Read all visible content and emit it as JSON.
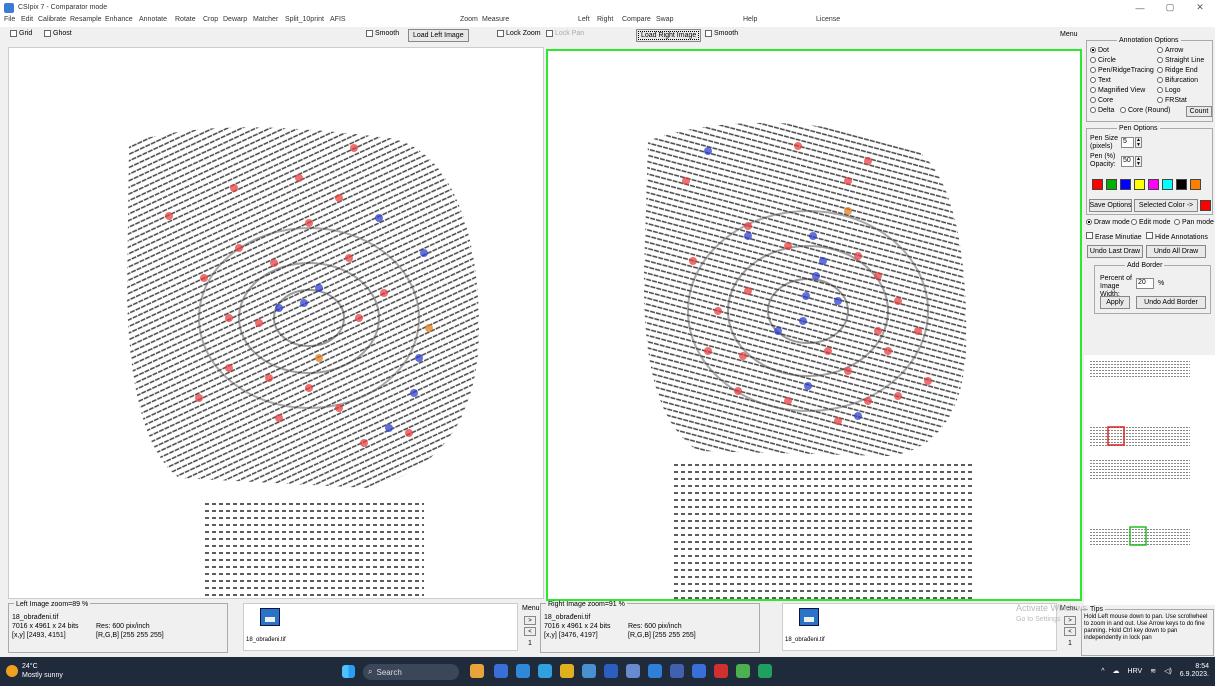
{
  "window": {
    "title": "CSIpix 7 - Comparator mode",
    "controls": [
      "—",
      "▢",
      "✕"
    ]
  },
  "menu": {
    "items": [
      "File",
      "Edit",
      "Calibrate",
      "Resample",
      "Enhance",
      "Annotate",
      "Rotate",
      "Crop",
      "Dewarp",
      "Matcher",
      "Split_10print",
      "AFIS",
      "Zoom",
      "Measure",
      "Left",
      "Right",
      "Compare",
      "Swap",
      "Help",
      "License"
    ]
  },
  "toolbar": {
    "grid": "Grid",
    "ghost": "Ghost",
    "smooth_left": "Smooth",
    "load_left": "Load Left Image",
    "lock_zoom": "Lock Zoom",
    "lock_pan": "Lock Pan",
    "load_right": "Load Right Image",
    "smooth_right": "Smooth",
    "menu": "Menu"
  },
  "annotation_options": {
    "title": "Annotation Options",
    "options": [
      "Dot",
      "Arrow",
      "Circle",
      "Straight Line",
      "Pen/RidgeTracing",
      "Ridge End",
      "Text",
      "Bifurcation",
      "Magnified View",
      "Logo",
      "Core",
      "FRStat",
      "Delta",
      "Core (Round)"
    ],
    "selected": "Dot",
    "count_btn": "Count"
  },
  "pen_options": {
    "title": "Pen Options",
    "pen_size_label": "Pen Size (pixels)",
    "pen_size": "5",
    "opacity_label": "Pen (%) Opacity:",
    "opacity": "50",
    "colors": [
      "#ff0000",
      "#00b000",
      "#0000ff",
      "#ffff00",
      "#ff00ff",
      "#00ffff",
      "#000000",
      "#ff8000"
    ],
    "save_options": "Save Options",
    "selected_color_label": "Selected Color ->",
    "selected_color": "#ff0000"
  },
  "modes": {
    "draw": "Draw mode",
    "edit": "Edit mode",
    "pan": "Pan mode",
    "erase_minutiae": "Erase Minutiae",
    "hide_annotations": "Hide Annotations",
    "undo_last": "Undo Last Draw",
    "undo_all": "Undo All Draw"
  },
  "add_border": {
    "title": "Add Border",
    "label": "Percent of Image Width:",
    "value": "20",
    "unit": "%",
    "apply": "Apply",
    "undo": "Undo Add Border"
  },
  "left_status": {
    "title": "Left Image",
    "zoom": "zoom=89 %",
    "file": "18_obrađeni.tif",
    "info": "7016 x 4961 x 24 bits",
    "res": "Res: 600 pix/inch",
    "coords": "[x,y] [2493, 4151]",
    "rgb": "[R,G,B] [255 255 255]",
    "thumb_name": "18_obrađeni.tif",
    "menu": "Menu",
    "page": "1"
  },
  "right_status": {
    "title": "Right Image",
    "zoom": "zoom=91 %",
    "file": "18_obrađeni.tif",
    "info": "7016 x 4961 x 24 bits",
    "res": "Res: 600 pix/inch",
    "coords": "[x,y] [3476, 4197]",
    "rgb": "[R,G,B] [255 255 255]",
    "thumb_name": "18_obrađeni.tif",
    "menu": "Menu",
    "page": "1"
  },
  "tips": {
    "title": "Tips",
    "text": "Hold Left mouse down to pan. Use scrollwheel to zoom in and out. Use Arrow keys to do fine panning. Hold Ctrl key down to pan independently in lock pan"
  },
  "watermark": {
    "line1": "Activate Windows",
    "line2": "Go to Settings"
  },
  "taskbar": {
    "temp": "24°C",
    "weather": "Mostly sunny",
    "search": "Search",
    "lang": "HRV",
    "time": "8:54",
    "date": "6.9.2023."
  }
}
